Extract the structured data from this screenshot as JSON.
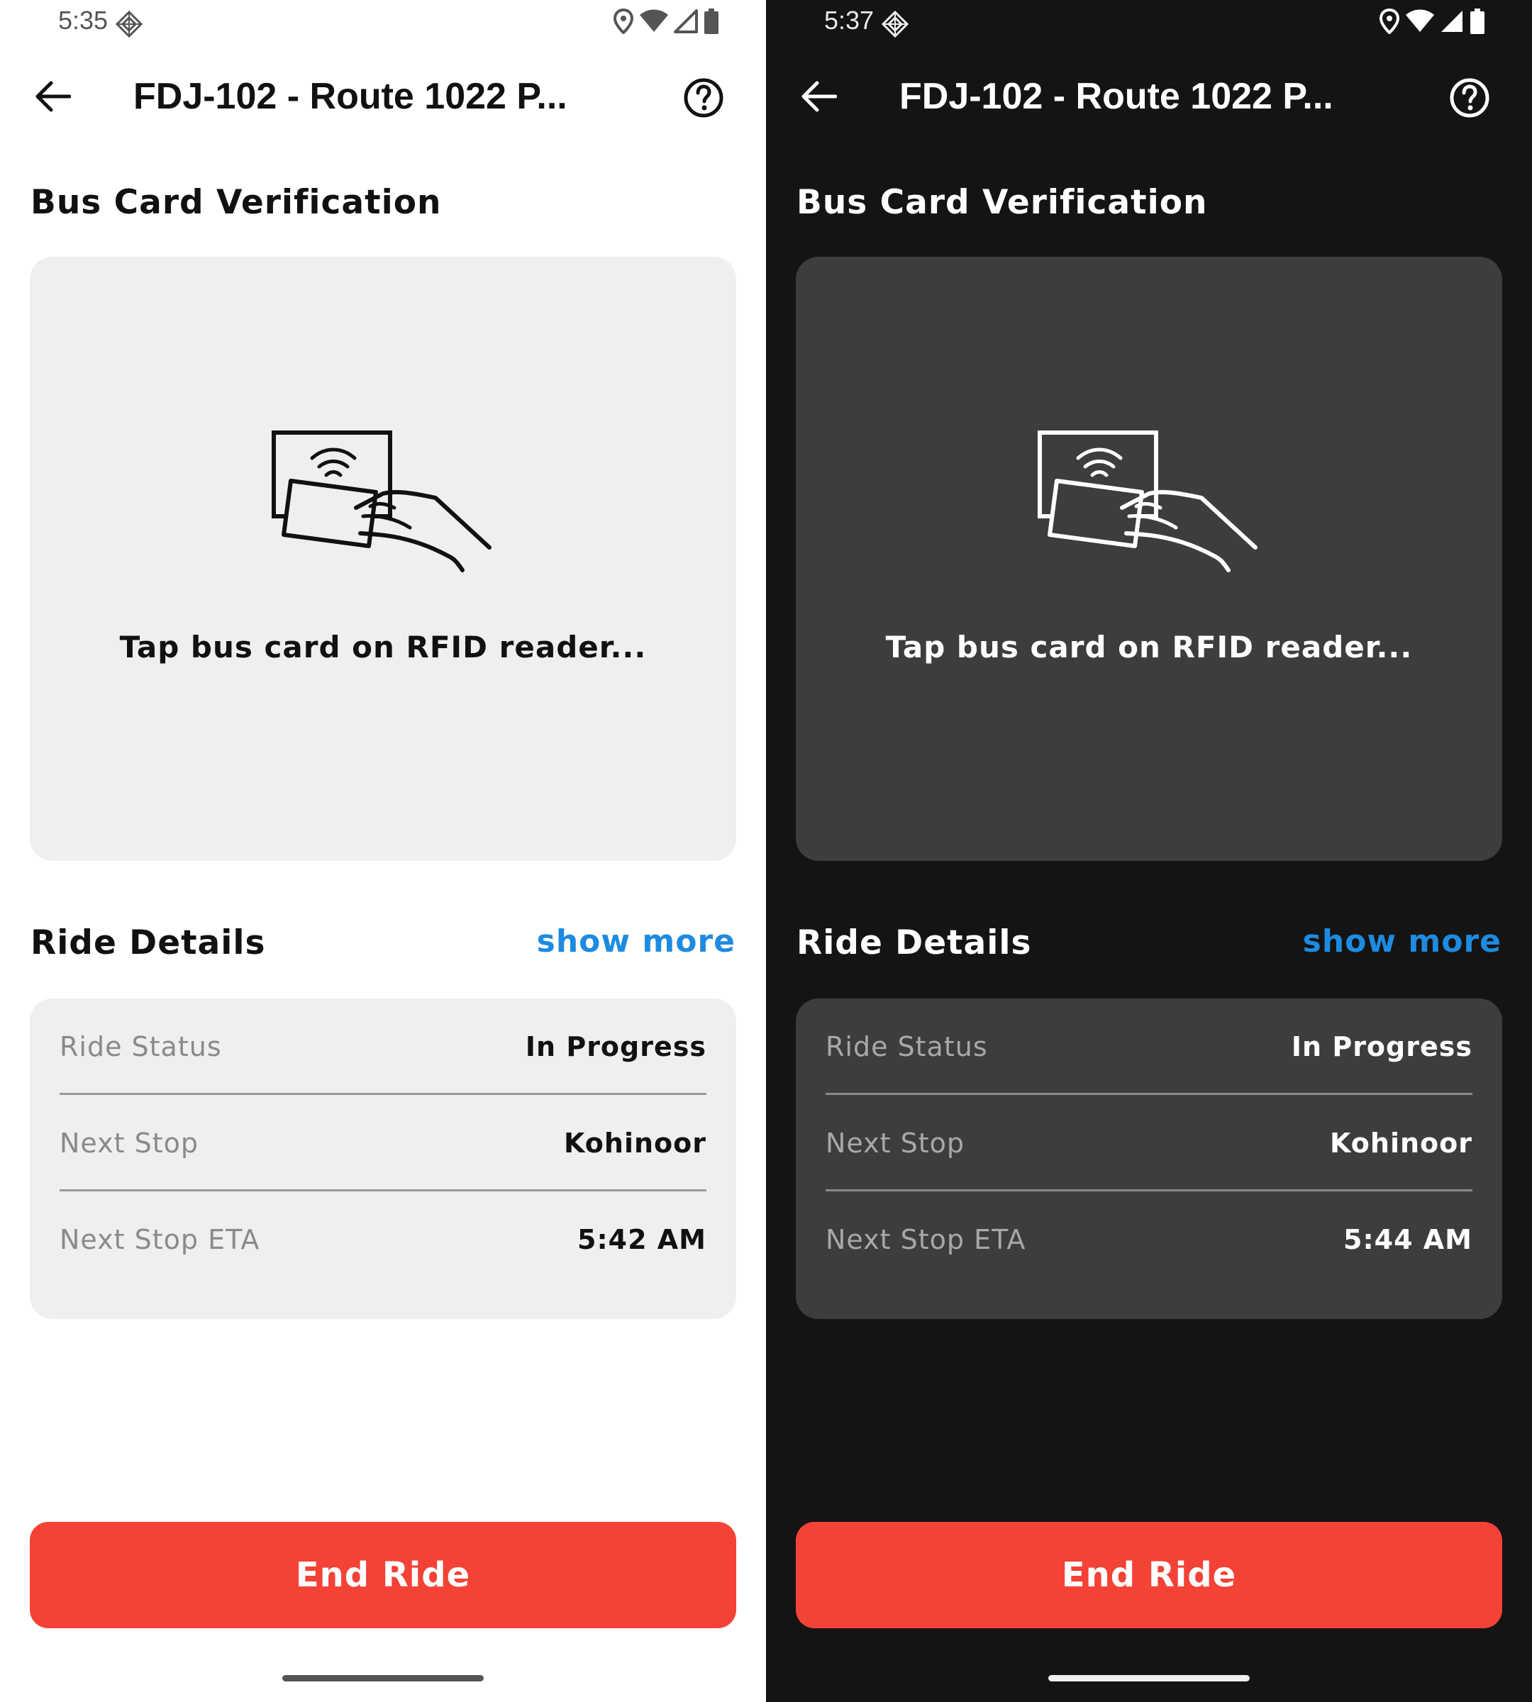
{
  "colors": {
    "accent_red": "#f44236",
    "link_blue": "#1e8be0",
    "light_bg": "#ffffff",
    "dark_bg": "#141414",
    "light_card": "#efefef",
    "dark_card": "#3d3d3f"
  },
  "screens": [
    {
      "theme": "light",
      "status_bar": {
        "time": "5:35",
        "icons": [
          "app-notification-icon",
          "location-icon",
          "wifi-icon",
          "cell-signal-icon",
          "battery-icon"
        ]
      },
      "app_bar": {
        "title": "FDJ-102 - Route 1022 P...",
        "back_icon": "arrow-left-icon",
        "help_icon": "help-circle-icon"
      },
      "verification": {
        "title": "Bus Card Verification",
        "illustration_icon": "rfid-card-tap-icon",
        "instruction": "Tap bus card on RFID reader..."
      },
      "ride_details": {
        "title": "Ride Details",
        "show_more": "show more",
        "rows": [
          {
            "label": "Ride Status",
            "value": "In Progress"
          },
          {
            "label": "Next Stop",
            "value": "Kohinoor"
          },
          {
            "label": "Next Stop ETA",
            "value": "5:42 AM"
          }
        ]
      },
      "end_ride_label": "End Ride"
    },
    {
      "theme": "dark",
      "status_bar": {
        "time": "5:37",
        "icons": [
          "app-notification-icon",
          "location-icon",
          "wifi-icon",
          "cell-signal-icon",
          "battery-icon"
        ]
      },
      "app_bar": {
        "title": "FDJ-102 - Route 1022 P...",
        "back_icon": "arrow-left-icon",
        "help_icon": "help-circle-icon"
      },
      "verification": {
        "title": "Bus Card Verification",
        "illustration_icon": "rfid-card-tap-icon",
        "instruction": "Tap bus card on RFID reader..."
      },
      "ride_details": {
        "title": "Ride Details",
        "show_more": "show more",
        "rows": [
          {
            "label": "Ride Status",
            "value": "In Progress"
          },
          {
            "label": "Next Stop",
            "value": "Kohinoor"
          },
          {
            "label": "Next Stop ETA",
            "value": "5:44 AM"
          }
        ]
      },
      "end_ride_label": "End Ride"
    }
  ]
}
